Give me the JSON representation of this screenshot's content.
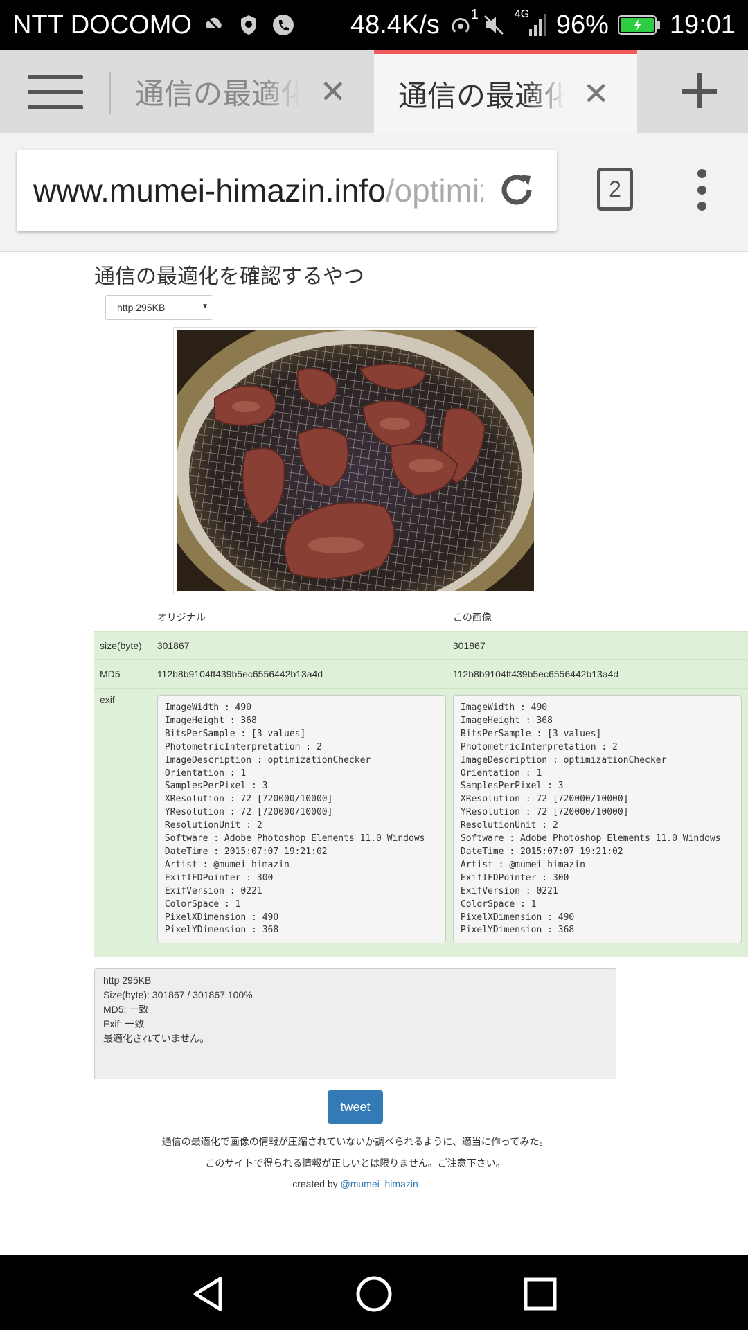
{
  "status_bar": {
    "carrier": "NTT DOCOMO",
    "network_speed": "48.4K/s",
    "signal_sup": "1",
    "network_type": "4G",
    "battery": "96%",
    "time": "19:01"
  },
  "tabs": [
    {
      "title": "通信の最適化を確認するやつ",
      "active": false
    },
    {
      "title": "通信の最適化を確認するやつ",
      "active": true
    }
  ],
  "toolbar": {
    "url_host": "www.mumei-himazin.info",
    "url_path": "/optimization",
    "tab_count": "2"
  },
  "page": {
    "title": "通信の最適化を確認するやつ",
    "select_value": "http 295KB",
    "table": {
      "headers": [
        "",
        "オリジナル",
        "この画像"
      ],
      "rows": [
        {
          "label": "size(byte)",
          "original": "301867",
          "current": "301867"
        },
        {
          "label": "MD5",
          "original": "112b8b9104ff439b5ec6556442b13a4d",
          "current": "112b8b9104ff439b5ec6556442b13a4d"
        },
        {
          "label": "exif",
          "original": "ImageWidth : 490\nImageHeight : 368\nBitsPerSample : [3 values]\nPhotometricInterpretation : 2\nImageDescription : optimizationChecker\nOrientation : 1\nSamplesPerPixel : 3\nXResolution : 72 [720000/10000]\nYResolution : 72 [720000/10000]\nResolutionUnit : 2\nSoftware : Adobe Photoshop Elements 11.0 Windows\nDateTime : 2015:07:07 19:21:02\nArtist : @mumei_himazin\nExifIFDPointer : 300\nExifVersion : 0221\nColorSpace : 1\nPixelXDimension : 490\nPixelYDimension : 368",
          "current": "ImageWidth : 490\nImageHeight : 368\nBitsPerSample : [3 values]\nPhotometricInterpretation : 2\nImageDescription : optimizationChecker\nOrientation : 1\nSamplesPerPixel : 3\nXResolution : 72 [720000/10000]\nYResolution : 72 [720000/10000]\nResolutionUnit : 2\nSoftware : Adobe Photoshop Elements 11.0 Windows\nDateTime : 2015:07:07 19:21:02\nArtist : @mumei_himazin\nExifIFDPointer : 300\nExifVersion : 0221\nColorSpace : 1\nPixelXDimension : 490\nPixelYDimension : 368"
        }
      ]
    },
    "result_lines": [
      "http 295KB",
      "Size(byte): 301867 / 301867 100%",
      "MD5: 一致",
      "Exif: 一致",
      "最適化されていません。"
    ],
    "tweet_label": "tweet",
    "note1": "通信の最適化で画像の情報が圧縮されていないか調べられるように、適当に作ってみた。",
    "note2": "このサイトで得られる情報が正しいとは限りません。ご注意下さい。",
    "credit_prefix": "created by ",
    "credit_link": "@mumei_himazin"
  },
  "colors": {
    "accent_tab": "#f05a5a",
    "row_green": "#dff0d8",
    "button_blue": "#337ab7",
    "battery_green": "#2ecc40"
  },
  "icons": [
    "menu-icon",
    "close-icon",
    "plus-icon",
    "reload-icon",
    "tab-switcher-icon",
    "overflow-menu-icon",
    "back-icon",
    "home-icon",
    "recents-icon"
  ]
}
